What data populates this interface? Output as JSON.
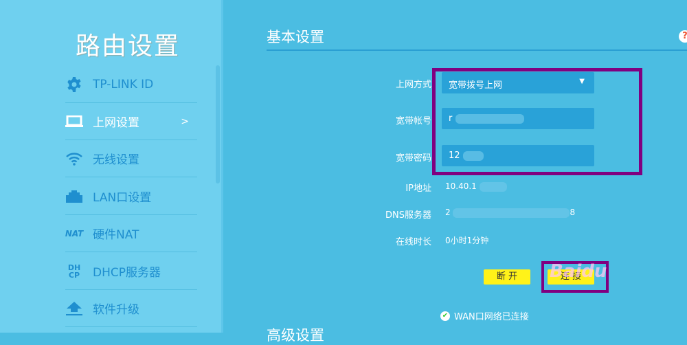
{
  "sidebar": {
    "title": "路由设置",
    "items": [
      {
        "label": "TP-LINK ID",
        "icon": "gear-icon"
      },
      {
        "label": "上网设置",
        "icon": "laptop-icon",
        "arrow": ">"
      },
      {
        "label": "无线设置",
        "icon": "wifi-icon"
      },
      {
        "label": "LAN口设置",
        "icon": "lan-port-icon"
      },
      {
        "label": "硬件NAT",
        "icon": "nat-icon",
        "glyph": "NAT"
      },
      {
        "label": "DHCP服务器",
        "icon": "dhcp-icon",
        "glyph": "DH CP"
      },
      {
        "label": "软件升级",
        "icon": "upload-icon"
      }
    ]
  },
  "main": {
    "heading": "基本设置",
    "help": "?",
    "form": {
      "conn_type_label": "上网方式",
      "conn_type_value": "宽带拨号上网",
      "account_label": "宽带帐号",
      "account_value": "r",
      "password_label": "宽带密码",
      "password_value": "12",
      "ip_label": "IP地址",
      "ip_value": "10.40.1",
      "dns_label": "DNS服务器",
      "dns_value": "2",
      "dns_value_end": "8",
      "uptime_label": "在线时长",
      "uptime_value": "0小时1分钟"
    },
    "disconnect": "断 开",
    "connect": "连 接",
    "status": "WAN口网络已连接",
    "advanced_heading": "高级设置"
  },
  "watermark": "Baidu",
  "colors": {
    "highlight": "#800080",
    "button": "#fff219",
    "bg": "#4bbde2"
  }
}
